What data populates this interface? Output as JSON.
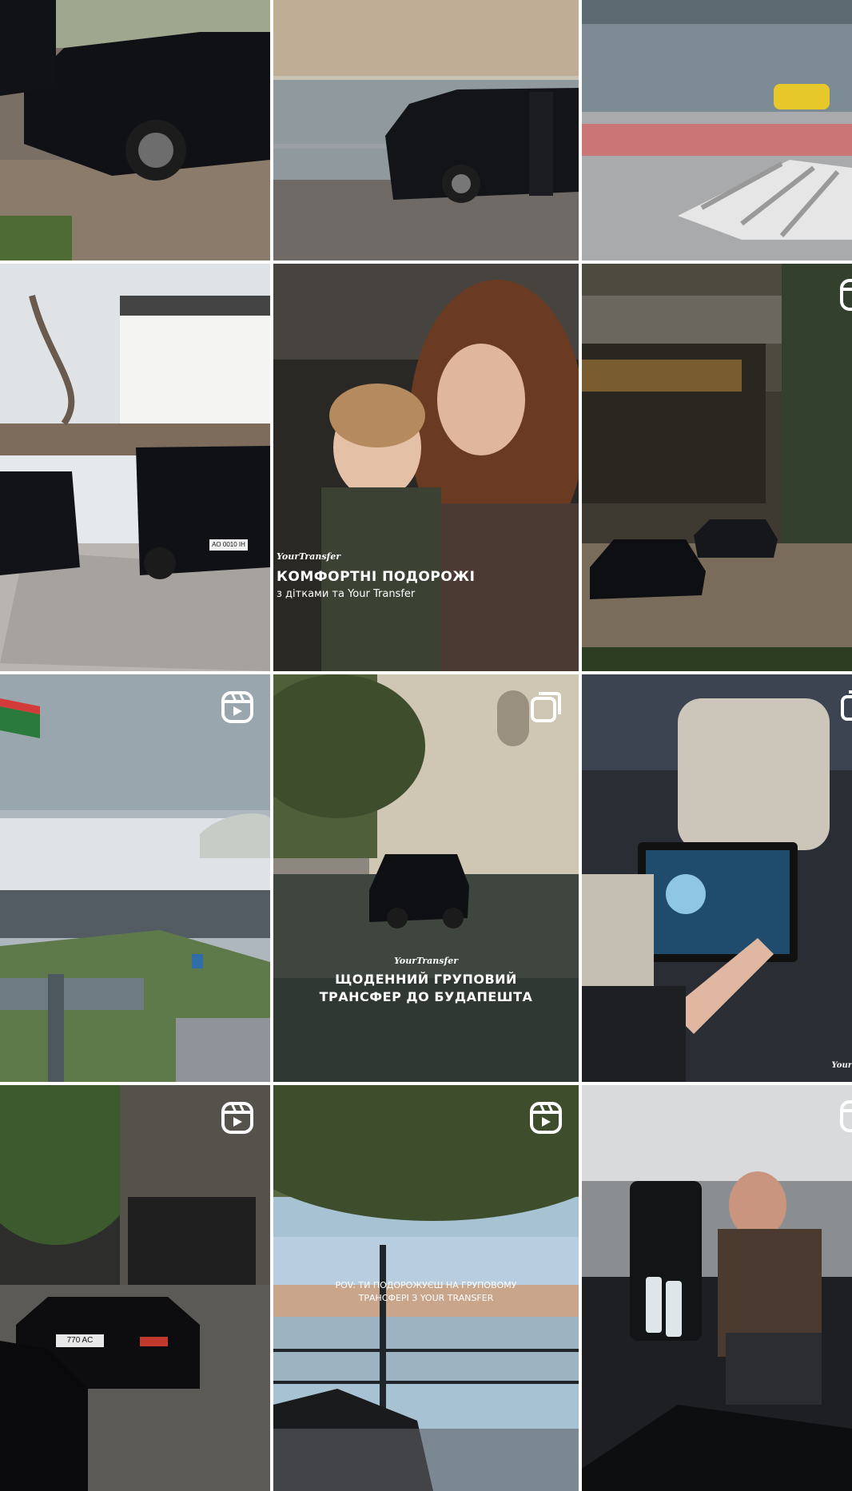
{
  "grid": {
    "tiles": [
      {
        "id": "r1c1",
        "kind": "photo",
        "description_icon": "none"
      },
      {
        "id": "r1c2",
        "kind": "photo",
        "description_icon": "none"
      },
      {
        "id": "r1c3",
        "kind": "photo",
        "description_icon": "none"
      },
      {
        "id": "r2c1",
        "kind": "photo",
        "description_icon": "none"
      },
      {
        "id": "r2c2",
        "kind": "photo",
        "description_icon": "none"
      },
      {
        "id": "r2c3",
        "kind": "photo",
        "description_icon": "reel-icon"
      },
      {
        "id": "r3c1",
        "kind": "reel",
        "description_icon": "reel-icon"
      },
      {
        "id": "r3c2",
        "kind": "carousel",
        "description_icon": "carousel-icon"
      },
      {
        "id": "r3c3",
        "kind": "photo",
        "description_icon": "carousel-icon"
      },
      {
        "id": "r4c1",
        "kind": "reel",
        "description_icon": "reel-icon"
      },
      {
        "id": "r4c2",
        "kind": "reel",
        "description_icon": "reel-icon"
      },
      {
        "id": "r4c3",
        "kind": "photo",
        "description_icon": "reel-icon"
      }
    ]
  },
  "posts": {
    "kids_post": {
      "brand": "YourTransfer",
      "headline": "КОМФОРТНІ ПОДОРОЖІ",
      "subline": "з дітками та Your Transfer"
    },
    "group_post": {
      "brand": "YourTransfer",
      "headline_line1": "ЩОДЕННИЙ ГРУПОВИЙ",
      "headline_line2": "ТРАНСФЕР ДО БУДАПЕШТА"
    },
    "budapest_post": {
      "caption_line1": "POV: ТИ ПОДОРОЖУЄШ НА ГРУПОВОМУ",
      "caption_line2": "ТРАНСФЕРІ З YOUR TRANSFER"
    },
    "tablet_post": {
      "brand_corner": "Your"
    },
    "plates": {
      "van_plate": "AO 0010 IH",
      "sedan_plate": "770 AC",
      "car_plate_left": "AC",
      "car_plate_group": "AO 0010 IH"
    }
  },
  "colors": {
    "icon": "#ffffff",
    "text": "#ffffff",
    "separator": "#ffffff"
  }
}
